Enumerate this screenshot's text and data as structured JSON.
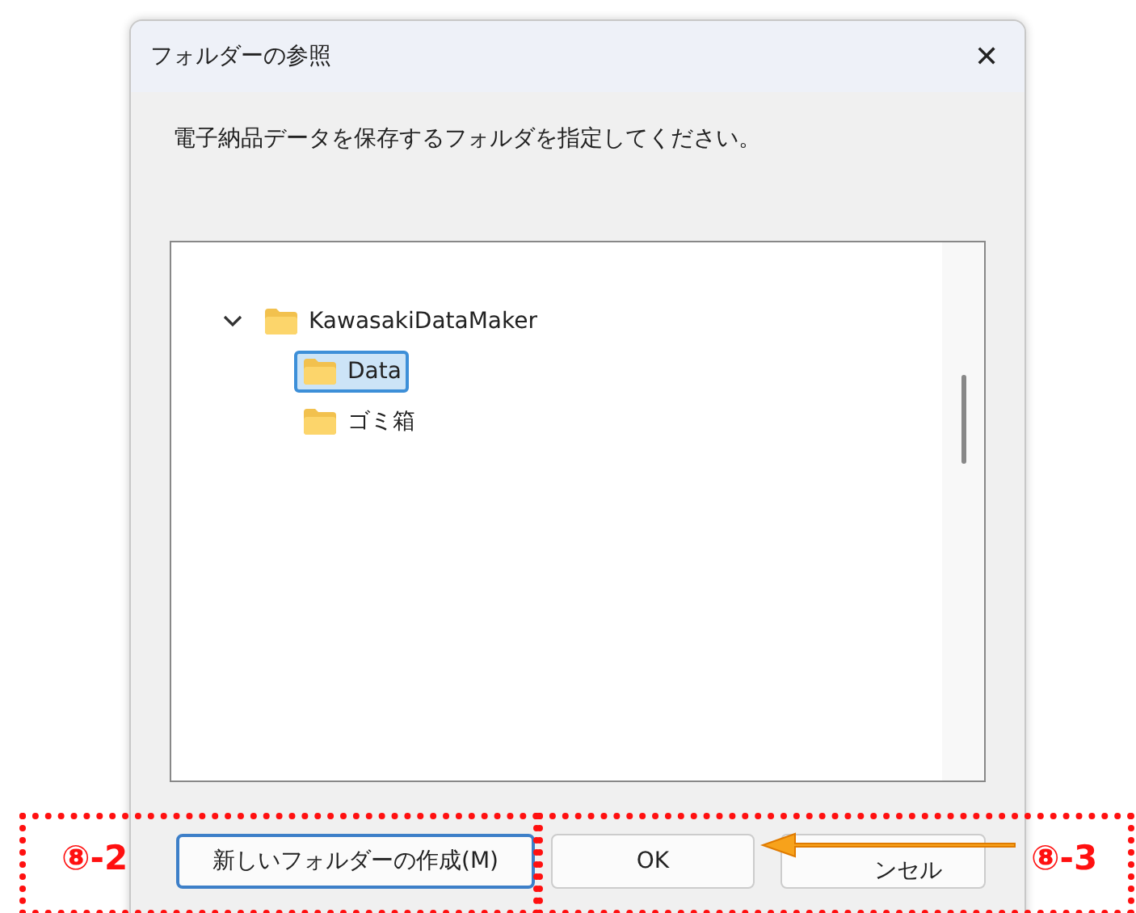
{
  "window": {
    "title": "フォルダーの参照",
    "close": "✕"
  },
  "instruction": "電子納品データを保存するフォルダを指定してください。",
  "tree": [
    {
      "label": "KawasakiDataMaker",
      "expanded": true,
      "selected": false,
      "children": [
        {
          "label": "Data",
          "selected": true
        },
        {
          "label": "ゴミ箱",
          "selected": false
        }
      ]
    }
  ],
  "buttons": [
    {
      "label": "新しいフォルダーの作成(M)",
      "kind": "new-folder",
      "focused": true
    },
    {
      "label": "OK",
      "kind": "ok",
      "focused": false
    },
    {
      "label": "ンセル",
      "kind": "cancel",
      "focused": false
    }
  ],
  "annotations": [
    {
      "label": "⑧-2",
      "kind": "left"
    },
    {
      "label": "⑧-3",
      "kind": "right"
    }
  ]
}
